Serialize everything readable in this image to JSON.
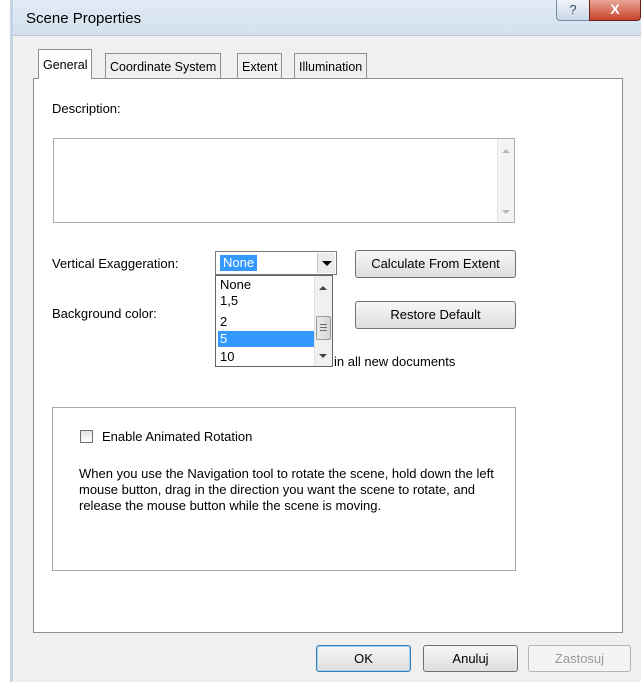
{
  "window": {
    "title": "Scene Properties",
    "help_glyph": "?",
    "close_glyph": "X"
  },
  "tabs": [
    {
      "label": "General",
      "active": true
    },
    {
      "label": "Coordinate System",
      "active": false
    },
    {
      "label": "Extent",
      "active": false
    },
    {
      "label": "Illumination",
      "active": false
    }
  ],
  "general": {
    "description_label": "Description:",
    "description_value": "",
    "vertical_exaggeration_label": "Vertical Exaggeration:",
    "vertical_exaggeration_value": "None",
    "calculate_button": "Calculate From Extent",
    "background_color_label": "Background color:",
    "restore_default_button": "Restore Default",
    "partial_text": "in all new documents",
    "dropdown_options": [
      "None",
      "1,5",
      "2",
      "5",
      "10"
    ],
    "dropdown_selected": "5",
    "animated_rotation": {
      "checkbox_label": "Enable Animated Rotation",
      "checked": false,
      "help_text": "When you use the Navigation tool to rotate the scene, hold down the left mouse button, drag in the direction you want the scene to rotate, and release the mouse button while the scene is moving."
    }
  },
  "footer": {
    "ok_label": "OK",
    "cancel_label": "Anuluj",
    "apply_label": "Zastosuj"
  },
  "colors": {
    "selection": "#3399ff",
    "close_button": "#c7432c",
    "titlebar": "#d4e0ee"
  }
}
